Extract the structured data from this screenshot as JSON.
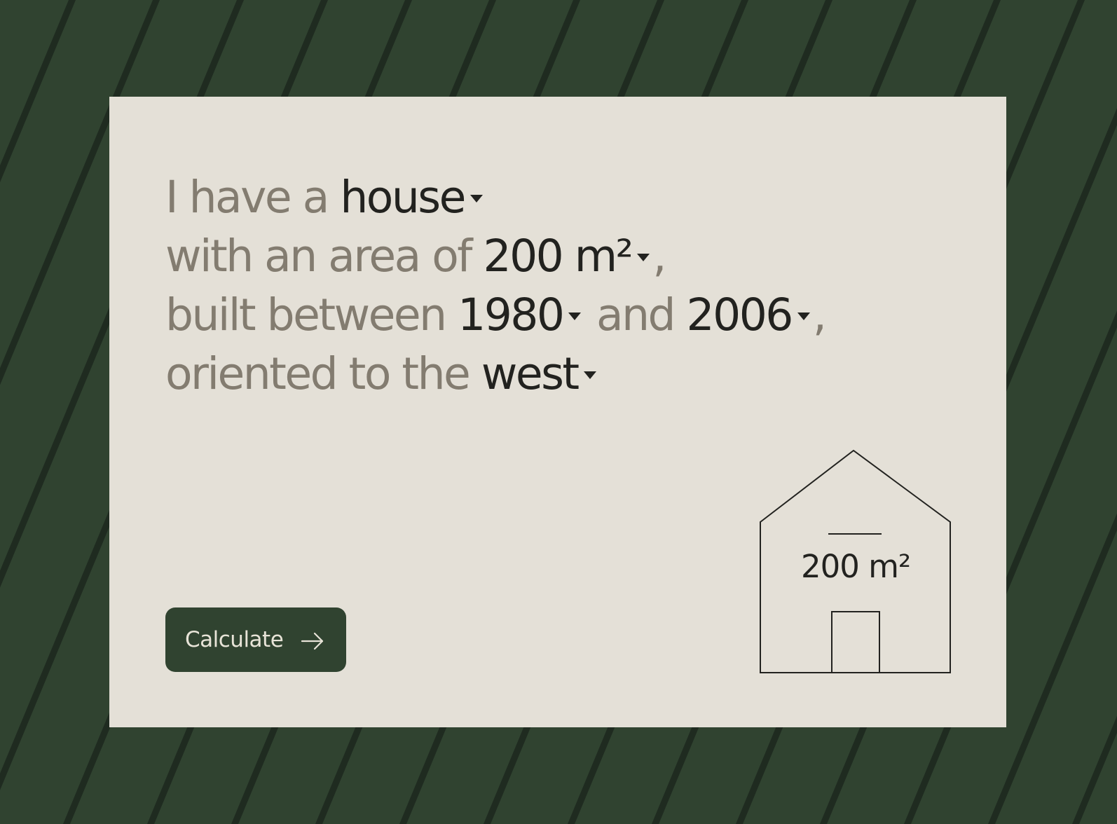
{
  "colors": {
    "background": "#1f2b20",
    "stripe": "#304330",
    "card": "#e4e0d7",
    "muted_text": "#837c70",
    "strong_text": "#22221f",
    "button": "#304330",
    "button_text": "#e8e4d8"
  },
  "sentence": {
    "line1": {
      "prefix": "I have a ",
      "property_type": "house",
      "suffix": ""
    },
    "line2": {
      "prefix": "with an area of ",
      "area": "200 m²",
      "suffix": ","
    },
    "line3": {
      "prefix": "built between ",
      "year_from": "1980",
      "middle": " and ",
      "year_to": "2006",
      "suffix": ","
    },
    "line4": {
      "prefix": "oriented to the ",
      "orientation": "west",
      "suffix": ""
    }
  },
  "button": {
    "label": "Calculate",
    "icon": "arrow-right-icon"
  },
  "illustration": {
    "icon": "house-outline-icon",
    "area_label": "200 m²"
  }
}
